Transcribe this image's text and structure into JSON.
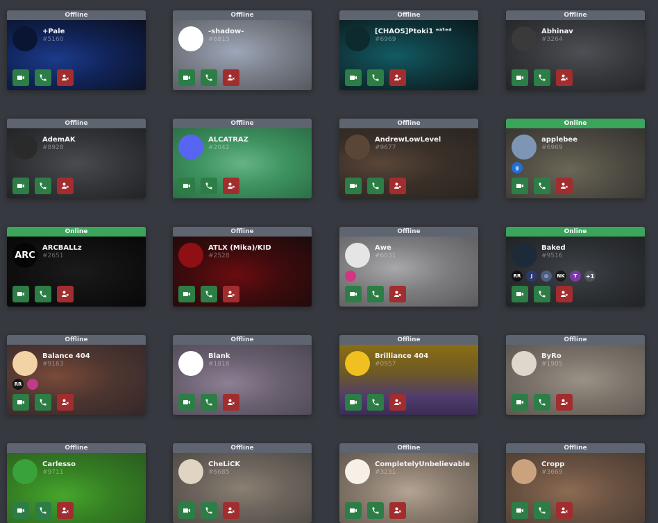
{
  "icons": {
    "video": "video-camera-icon",
    "call": "phone-icon",
    "remove": "remove-friend-icon"
  },
  "colors": {
    "online": "#3ba55c",
    "offline": "#5e6470",
    "call_button": "#2d7d46",
    "remove_button": "#a12d2f"
  },
  "cards": [
    {
      "status": "Offline",
      "name": "+Pale",
      "tag": "#5160",
      "bg": "radial-gradient(ellipse at 35% 55%, #1c3b8c 0%, #102356 45%, #0b1020 100%)",
      "avatar_bg": "#0a1433",
      "avatar_text": "",
      "badges": []
    },
    {
      "status": "Offline",
      "name": "-shadow-",
      "tag": "#6813",
      "bg": "radial-gradient(ellipse at 45% 45%, #9da6ba 0%, #7a7f89 45%, #55585f 100%)",
      "avatar_bg": "#ffffff",
      "avatar_text": "",
      "badges": []
    },
    {
      "status": "Offline",
      "name": "[CHAOS]Ptoki1 ᵉᵃ͠ᵗᵉᵈ",
      "tag": "#6969",
      "bg": "radial-gradient(ellipse at 40% 50%, #125b63 0%, #0f3a40 45%, #0a1a1d 100%)",
      "avatar_bg": "#0d2a2e",
      "avatar_text": "",
      "badges": []
    },
    {
      "status": "Offline",
      "name": "Abhinav",
      "tag": "#3264",
      "bg": "radial-gradient(ellipse at 55% 45%, #4d4f54 0%, #35373b 50%, #232427 100%)",
      "avatar_bg": "#3a3a3a",
      "avatar_text": "",
      "badges": []
    },
    {
      "status": "Offline",
      "name": "AdemAK",
      "tag": "#8928",
      "bg": "radial-gradient(ellipse at 50% 50%, #494b4e 0%, #333538 50%, #222326 100%)",
      "avatar_bg": "#2a2a2a",
      "avatar_text": "",
      "badges": []
    },
    {
      "status": "Offline",
      "name": "ALCATRAZ",
      "tag": "#2042",
      "bg": "radial-gradient(ellipse at 50% 50%, #67b387 0%, #3e9360 45%, #2c6e47 100%)",
      "avatar_bg": "#5865f2",
      "avatar_text": "",
      "badges": []
    },
    {
      "status": "Offline",
      "name": "AndrewLowLevel",
      "tag": "#9677",
      "bg": "radial-gradient(ellipse at 30% 50%, #5a4638 0%, #3a3029 45%, #2a2420 100%)",
      "avatar_bg": "#5b4636",
      "avatar_text": "",
      "badges": []
    },
    {
      "status": "Online",
      "name": "applebee",
      "tag": "#6969",
      "bg": "radial-gradient(ellipse at 45% 60%, #6b6656 0%, #4d4a42 50%, #34332f 100%)",
      "avatar_bg": "#7e96b5",
      "avatar_text": "",
      "badges": [
        {
          "bg": "#1f6fd6",
          "t": "g"
        }
      ]
    },
    {
      "status": "Online",
      "name": "ARCBALLz",
      "tag": "#2651",
      "bg": "radial-gradient(ellipse at 50% 50%, #1a1a1a 0%, #0f0f0f 60%, #080808 100%)",
      "avatar_bg": "#050505",
      "avatar_text": "ARC",
      "badges": []
    },
    {
      "status": "Offline",
      "name": "ATLX (Mika)/KID",
      "tag": "#2528",
      "bg": "radial-gradient(ellipse at 45% 55%, #6b0c10 0%, #3d0b0d 45%, #1b0b0c 100%)",
      "avatar_bg": "#8e1015",
      "avatar_text": "",
      "badges": []
    },
    {
      "status": "Offline",
      "name": "Awe",
      "tag": "#6031",
      "bg": "radial-gradient(ellipse at 40% 45%, #a8a8aa 0%, #7d7d80 45%, #5a5a5d 100%)",
      "avatar_bg": "#e5e5e5",
      "avatar_text": "",
      "badges": [
        {
          "bg": "#d63384",
          "t": ""
        }
      ]
    },
    {
      "status": "Online",
      "name": "Baked",
      "tag": "#9516",
      "bg": "radial-gradient(ellipse at 50% 50%, #3f4347 0%, #2d3034 50%, #212326 100%)",
      "avatar_bg": "#1c2a3a",
      "avatar_text": "",
      "badges": [
        {
          "bg": "#111111",
          "t": "RR"
        },
        {
          "bg": "#2b3a6b",
          "t": "J"
        },
        {
          "bg": "#4b5d82",
          "t": "◎"
        },
        {
          "bg": "#1b1b1b",
          "t": "NK"
        },
        {
          "bg": "#7a3aa8",
          "t": "T"
        }
      ],
      "more": "+1"
    },
    {
      "status": "Offline",
      "name": "Balance 404",
      "tag": "#9163",
      "bg": "radial-gradient(ellipse at 35% 45%, #7a4a3a 0%, #4e3630 45%, #33272a 100%)",
      "avatar_bg": "#f3d3a5",
      "avatar_text": "",
      "badges": [
        {
          "bg": "#151515",
          "t": "RR"
        },
        {
          "bg": "#c23a8a",
          "t": ""
        }
      ]
    },
    {
      "status": "Offline",
      "name": "Blank",
      "tag": "#1818",
      "bg": "radial-gradient(ellipse at 40% 55%, #8d7f94 0%, #6a6070 45%, #4c4752 100%)",
      "avatar_bg": "#ffffff",
      "avatar_text": "",
      "badges": []
    },
    {
      "status": "Offline",
      "name": "Brilliance 404",
      "tag": "#0957",
      "bg": "linear-gradient(180deg, #8a6d13 0%, #6e5a25 40%, #4f3c6e 75%, #3b2d55 100%)",
      "avatar_bg": "#f0c020",
      "avatar_text": "",
      "badges": []
    },
    {
      "status": "Offline",
      "name": "ByRo",
      "tag": "#1905",
      "bg": "radial-gradient(ellipse at 55% 50%, #9a9186 0%, #7c746b 45%, #5d5852 100%)",
      "avatar_bg": "#ded7cb",
      "avatar_text": "",
      "badges": []
    },
    {
      "status": "Offline",
      "name": "Carlesso",
      "tag": "#9711",
      "bg": "radial-gradient(ellipse at 40% 60%, #46a62c 0%, #357e23 45%, #2a5c1f 100%)",
      "avatar_bg": "#3aa23a",
      "avatar_text": "",
      "badges": []
    },
    {
      "status": "Offline",
      "name": "CheLiCK",
      "tag": "#6685",
      "bg": "radial-gradient(ellipse at 50% 50%, #8a8073 0%, #6d655d 45%, #514c47 100%)",
      "avatar_bg": "#e0d4c2",
      "avatar_text": "",
      "badges": []
    },
    {
      "status": "Offline",
      "name": "CompletelyUnbelievable",
      "tag": "#3231",
      "bg": "radial-gradient(ellipse at 50% 55%, #b3a494 0%, #8a7c6e 45%, #655a51 100%)",
      "avatar_bg": "#f6f0e6",
      "avatar_text": "",
      "badges": []
    },
    {
      "status": "Offline",
      "name": "Cropp",
      "tag": "#3669",
      "bg": "radial-gradient(ellipse at 45% 55%, #8c6b53 0%, #6a5242 45%, #4b3c32 100%)",
      "avatar_bg": "#caa27e",
      "avatar_text": "",
      "badges": []
    }
  ]
}
